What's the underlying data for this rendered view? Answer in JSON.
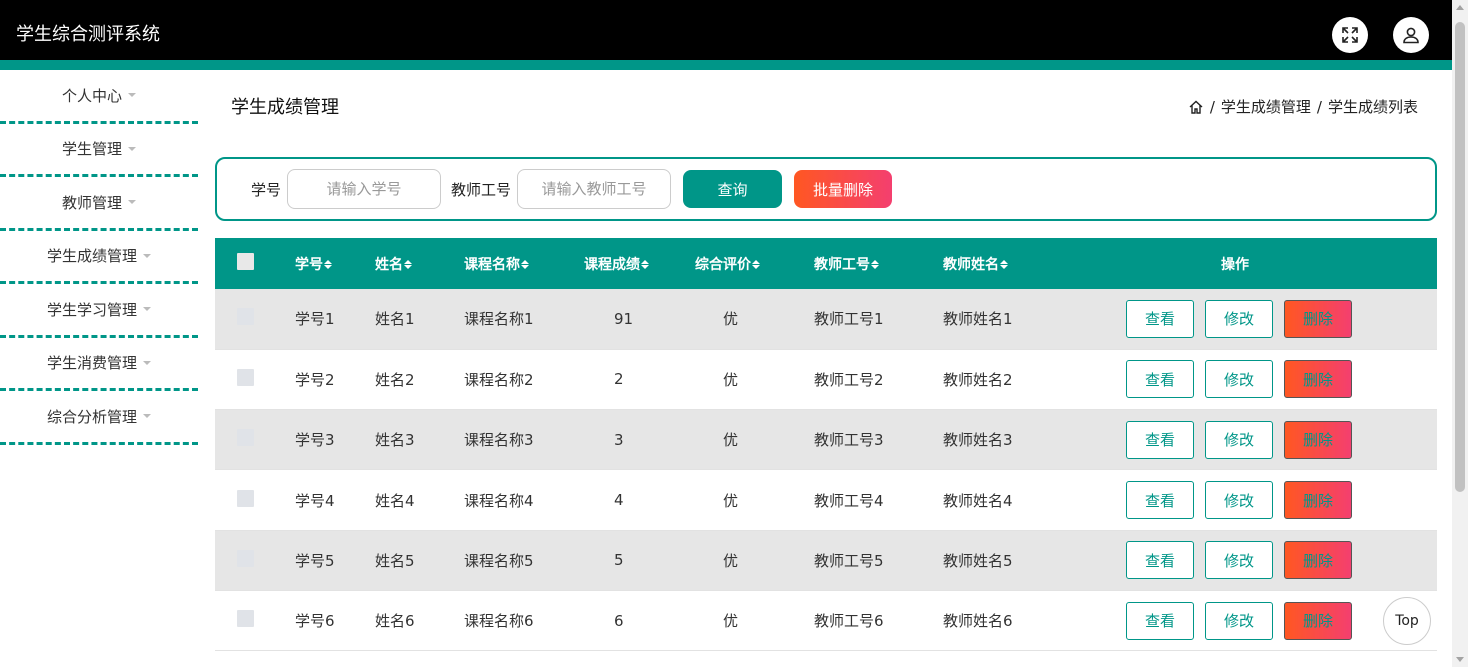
{
  "app": {
    "title": "学生综合测评系统",
    "colors": {
      "accent": "#009688",
      "danger_gradient_start": "#ff5722",
      "danger_gradient_end": "#f43f6f",
      "header_bg": "#000000"
    },
    "header_icons": [
      "fullscreen-icon",
      "user-icon"
    ]
  },
  "sidebar": {
    "items": [
      {
        "label": "个人中心"
      },
      {
        "label": "学生管理"
      },
      {
        "label": "教师管理"
      },
      {
        "label": "学生成绩管理"
      },
      {
        "label": "学生学习管理"
      },
      {
        "label": "学生消费管理"
      },
      {
        "label": "综合分析管理"
      }
    ]
  },
  "page": {
    "title": "学生成绩管理",
    "breadcrumb": [
      "学生成绩管理",
      "学生成绩列表"
    ],
    "breadcrumb_separator": "/"
  },
  "search": {
    "student_id_label": "学号",
    "student_id_placeholder": "请输入学号",
    "student_id_value": "",
    "teacher_id_label": "教师工号",
    "teacher_id_placeholder": "请输入教师工号",
    "teacher_id_value": "",
    "query_label": "查询",
    "batch_delete_label": "批量删除"
  },
  "table": {
    "columns": [
      "学号",
      "姓名",
      "课程名称",
      "课程成绩",
      "综合评价",
      "教师工号",
      "教师姓名",
      "操作"
    ],
    "actions": {
      "view": "查看",
      "edit": "修改",
      "delete": "删除"
    },
    "rows": [
      {
        "student_id": "学号1",
        "name": "姓名1",
        "course": "课程名称1",
        "score": "91",
        "evaluation": "优",
        "teacher_id": "教师工号1",
        "teacher_name": "教师姓名1"
      },
      {
        "student_id": "学号2",
        "name": "姓名2",
        "course": "课程名称2",
        "score": "2",
        "evaluation": "优",
        "teacher_id": "教师工号2",
        "teacher_name": "教师姓名2"
      },
      {
        "student_id": "学号3",
        "name": "姓名3",
        "course": "课程名称3",
        "score": "3",
        "evaluation": "优",
        "teacher_id": "教师工号3",
        "teacher_name": "教师姓名3"
      },
      {
        "student_id": "学号4",
        "name": "姓名4",
        "course": "课程名称4",
        "score": "4",
        "evaluation": "优",
        "teacher_id": "教师工号4",
        "teacher_name": "教师姓名4"
      },
      {
        "student_id": "学号5",
        "name": "姓名5",
        "course": "课程名称5",
        "score": "5",
        "evaluation": "优",
        "teacher_id": "教师工号5",
        "teacher_name": "教师姓名5"
      },
      {
        "student_id": "学号6",
        "name": "姓名6",
        "course": "课程名称6",
        "score": "6",
        "evaluation": "优",
        "teacher_id": "教师工号6",
        "teacher_name": "教师姓名6"
      }
    ]
  },
  "back_to_top": {
    "label": "Top"
  }
}
